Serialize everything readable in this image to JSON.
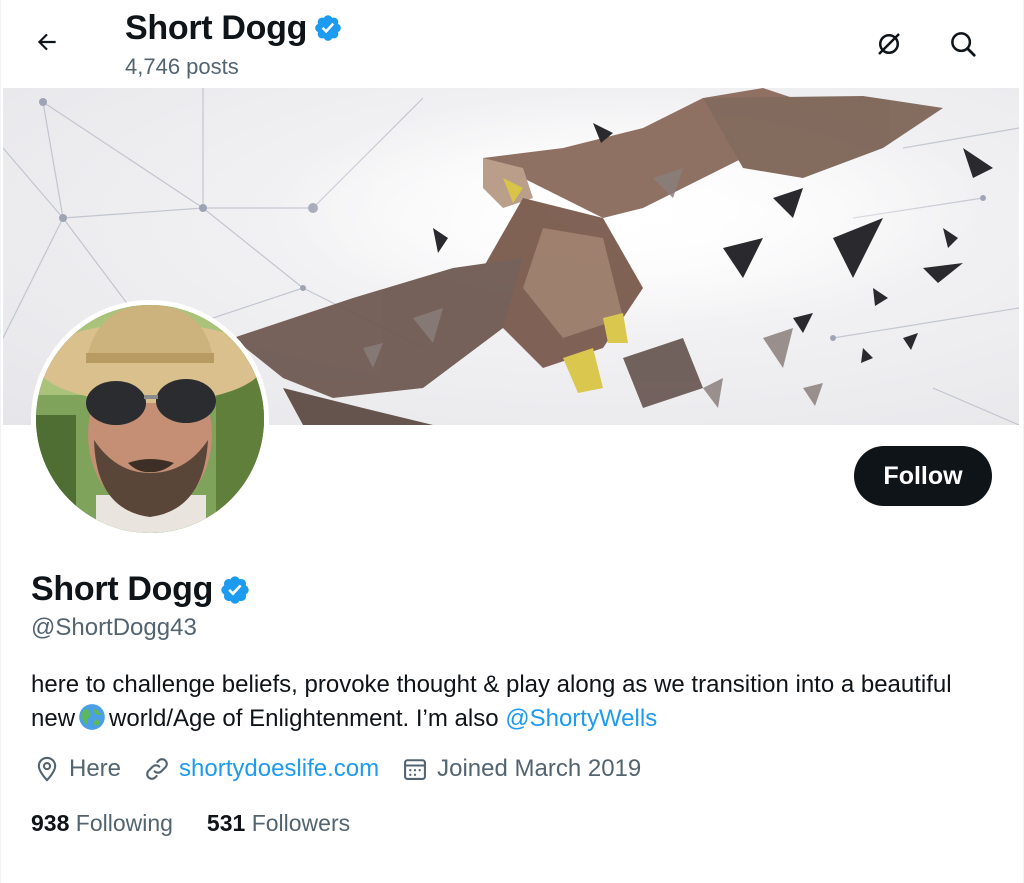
{
  "header": {
    "name": "Short Dogg",
    "posts_count": "4,746 posts"
  },
  "profile": {
    "display_name": "Short Dogg",
    "handle": "@ShortDogg43",
    "follow_label": "Follow",
    "bio_part1": "here to challenge beliefs, provoke thought & play along as we transition into a beautiful new",
    "bio_part2": "world/Age of Enlightenment. I’m also ",
    "bio_mention": "@ShortyWells",
    "location": "Here",
    "website": "shortydoeslife.com",
    "joined": "Joined March 2019",
    "following_count": "938",
    "following_label": "Following",
    "followers_count": "531",
    "followers_label": "Followers"
  },
  "icons": {
    "back": "arrow-left-icon",
    "grok": "slashed-circle-icon",
    "search": "search-icon",
    "verified": "verified-badge-icon",
    "location": "map-pin-icon",
    "link": "link-icon",
    "calendar": "calendar-icon",
    "globe": "globe-emoji-icon"
  },
  "colors": {
    "accent": "#1d9bf0",
    "text": "#0f1419",
    "muted": "#536471",
    "button_bg": "#0f1419"
  }
}
